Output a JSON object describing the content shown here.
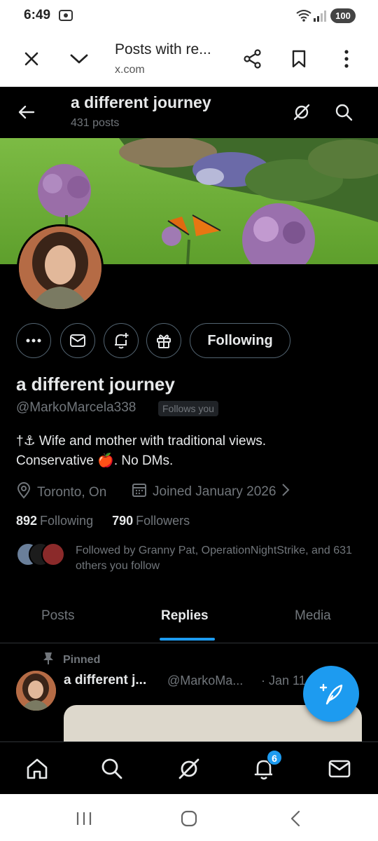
{
  "status_bar": {
    "time": "6:49",
    "battery": "100"
  },
  "browser": {
    "title": "Posts with re...",
    "url": "x.com"
  },
  "header": {
    "name": "a different journey",
    "post_count": "431 posts"
  },
  "profile": {
    "display_name": "a different journey",
    "handle": "@MarkoMarcela338",
    "follows_you": "Follows you",
    "bio_line1": "†⚓ Wife and mother with traditional views.",
    "bio_line2": "Conservative 🍎. No DMs.",
    "location": "Toronto, On",
    "joined": "Joined January 2026",
    "following_count": "892",
    "following_label": "Following",
    "followers_count": "790",
    "followers_label": "Followers",
    "followed_by": "Followed by Granny Pat, OperationNightStrike, and 631 others you follow",
    "follow_button": "Following"
  },
  "tabs": [
    {
      "label": "Posts",
      "active": false
    },
    {
      "label": "Replies",
      "active": true
    },
    {
      "label": "Media",
      "active": false
    }
  ],
  "pinned_post": {
    "pinned_label": "Pinned",
    "name": "a different j...",
    "handle": "@MarkoMa...",
    "date": "· Jan 11"
  },
  "bottom_nav": {
    "notifications_badge": "6"
  },
  "colors": {
    "accent": "#1d9bf0",
    "background": "#000000",
    "text_primary": "#e7e9ea",
    "text_secondary": "#71767b"
  }
}
